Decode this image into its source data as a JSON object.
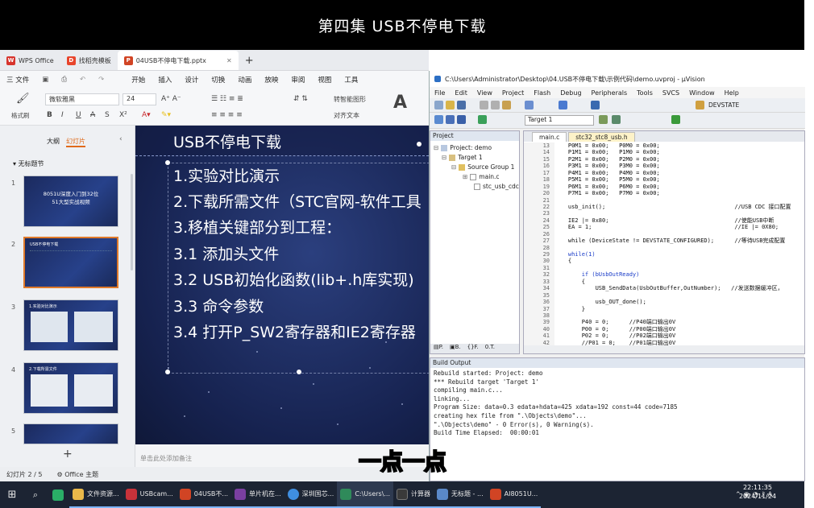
{
  "banner": {
    "title": "第四集 USB不停电下载"
  },
  "wps": {
    "tabs": [
      {
        "label": "WPS Office",
        "icon": "wps-logo-icon",
        "color": "#d7342d"
      },
      {
        "label": "找稻壳模板",
        "icon": "docer-icon",
        "color": "#e8452c"
      },
      {
        "label": "04USB不停电下载.pptx",
        "icon": "ppt-icon",
        "color": "#d14424"
      }
    ],
    "menu": {
      "file": "三 文件",
      "items": [
        "开始",
        "插入",
        "设计",
        "切换",
        "动画",
        "放映",
        "审阅",
        "视图",
        "工具"
      ]
    },
    "ribbon": {
      "format_painter": "格式刷",
      "font": "微软雅黑",
      "size": "24",
      "convert": "转智能图形",
      "align": "对齐文本"
    },
    "panel_tabs": {
      "outline": "大纲",
      "slides": "幻灯片"
    },
    "section": "无标题节",
    "thumbnails": [
      {
        "num": "1",
        "title": "8051U深度入门到32位",
        "subtitle": "51大型实战视频"
      },
      {
        "num": "2",
        "title": "USB不停电下载"
      },
      {
        "num": "3",
        "title": "1.实验对比演示"
      },
      {
        "num": "4",
        "title": "2.下载所需文件"
      },
      {
        "num": "5",
        "title": ""
      }
    ],
    "slide": {
      "title": "USB不停电下载",
      "lines": [
        "1.实验对比演示",
        "2.下载所需文件（STC官网-软件工具",
        "3.移植关键部分到工程：",
        "3.1 添加头文件",
        "3.2 USB初始化函数(lib+.h库实现)",
        "3.3 命令参数",
        "3.4 打开P_SW2寄存器和IE2寄存器"
      ]
    },
    "notes_placeholder": "单击此处添加备注",
    "status": {
      "slide_count": "幻灯片 2 / 5",
      "theme": "Office 主题"
    }
  },
  "uvision": {
    "title": "C:\\Users\\Administrator\\Desktop\\04.USB不停电下载\\示例代码\\demo.uvproj - µVision",
    "menu": [
      "File",
      "Edit",
      "View",
      "Project",
      "Flash",
      "Debug",
      "Peripherals",
      "Tools",
      "SVCS",
      "Window",
      "Help"
    ],
    "target_select": "Target 1",
    "devstate": "DEVSTATE",
    "project": {
      "header": "Project",
      "tree": [
        "Project: demo",
        "Target 1",
        "Source Group 1",
        "main.c",
        "stc_usb_cdc"
      ]
    },
    "editor_tabs": [
      "main.c",
      "stc32_stc8_usb.h"
    ],
    "code": [
      {
        "n": "13",
        "t": "    P0M1 = 0x00;   P0M0 = 0x00;"
      },
      {
        "n": "14",
        "t": "    P1M1 = 0x00;   P1M0 = 0x00;"
      },
      {
        "n": "15",
        "t": "    P2M1 = 0x00;   P2M0 = 0x00;"
      },
      {
        "n": "16",
        "t": "    P3M1 = 0x00;   P3M0 = 0x00;"
      },
      {
        "n": "17",
        "t": "    P4M1 = 0x00;   P4M0 = 0x00;"
      },
      {
        "n": "18",
        "t": "    P5M1 = 0x00;   P5M0 = 0x00;"
      },
      {
        "n": "19",
        "t": "    P6M1 = 0x00;   P6M0 = 0x00;"
      },
      {
        "n": "20",
        "t": "    P7M1 = 0x00;   P7M0 = 0x00;"
      },
      {
        "n": "21",
        "t": ""
      },
      {
        "n": "22",
        "t": "    usb_init();                                      //USB CDC 接口配置"
      },
      {
        "n": "23",
        "t": ""
      },
      {
        "n": "24",
        "t": "    IE2 |= 0x80;                                     //使能USB中断"
      },
      {
        "n": "25",
        "t": "    EA = 1;                                          //IE |= 0X80;"
      },
      {
        "n": "26",
        "t": ""
      },
      {
        "n": "27",
        "t": "    while (DeviceState != DEVSTATE_CONFIGURED);      //等待USB完成配置"
      },
      {
        "n": "28",
        "t": ""
      },
      {
        "n": "29",
        "t": "    while(1)"
      },
      {
        "n": "30",
        "t": "    {"
      },
      {
        "n": "31",
        "t": ""
      },
      {
        "n": "32",
        "t": "        if (bUsbOutReady)"
      },
      {
        "n": "33",
        "t": "        {"
      },
      {
        "n": "34",
        "t": "            USB_SendData(UsbOutBuffer,OutNumber);   //发送数据缓冲区，"
      },
      {
        "n": "35",
        "t": ""
      },
      {
        "n": "36",
        "t": "            usb_OUT_done();"
      },
      {
        "n": "37",
        "t": "        }"
      },
      {
        "n": "38",
        "t": ""
      },
      {
        "n": "39",
        "t": "        P40 = 0;      //P40端口输出0V"
      },
      {
        "n": "40",
        "t": "        P00 = 0;      //P00端口输出0V"
      },
      {
        "n": "41",
        "t": "        P02 = 0;      //P02端口输出0V"
      },
      {
        "n": "42",
        "t": "        //P01 = 0;    //P01端口输出0V"
      }
    ],
    "build": {
      "header": "Build Output",
      "text": "Rebuild started: Project: demo\n*** Rebuild target 'Target 1'\ncompiling main.c...\nlinking...\nProgram Size: data=0.3 edata+hdata=425 xdata=192 const=44 code=7185\ncreating hex file from \".\\Objects\\demo\"...\n\".\\Objects\\demo\" - 0 Error(s), 0 Warning(s).\nBuild Time Elapsed:  00:00:01"
    }
  },
  "subtitle": "一点一点",
  "taskbar": {
    "items": [
      {
        "label": "文件资源...",
        "color": "#e9b84a"
      },
      {
        "label": "USBcam...",
        "color": "#c8323a"
      },
      {
        "label": "04USB不...",
        "color": "#d14424"
      },
      {
        "label": "单片机在...",
        "color": "#7a3fa0"
      },
      {
        "label": "深圳国芯...",
        "color": "#3f8ee0"
      },
      {
        "label": "C:\\Users\\...",
        "color": "#2f8a5a"
      },
      {
        "label": "计算器",
        "color": "#3a3a3a"
      },
      {
        "label": "无标题 - ...",
        "color": "#5a88c8"
      },
      {
        "label": "AI8051U...",
        "color": "#d14424"
      }
    ],
    "time": "22:11:35",
    "date": "2024/11/24"
  }
}
